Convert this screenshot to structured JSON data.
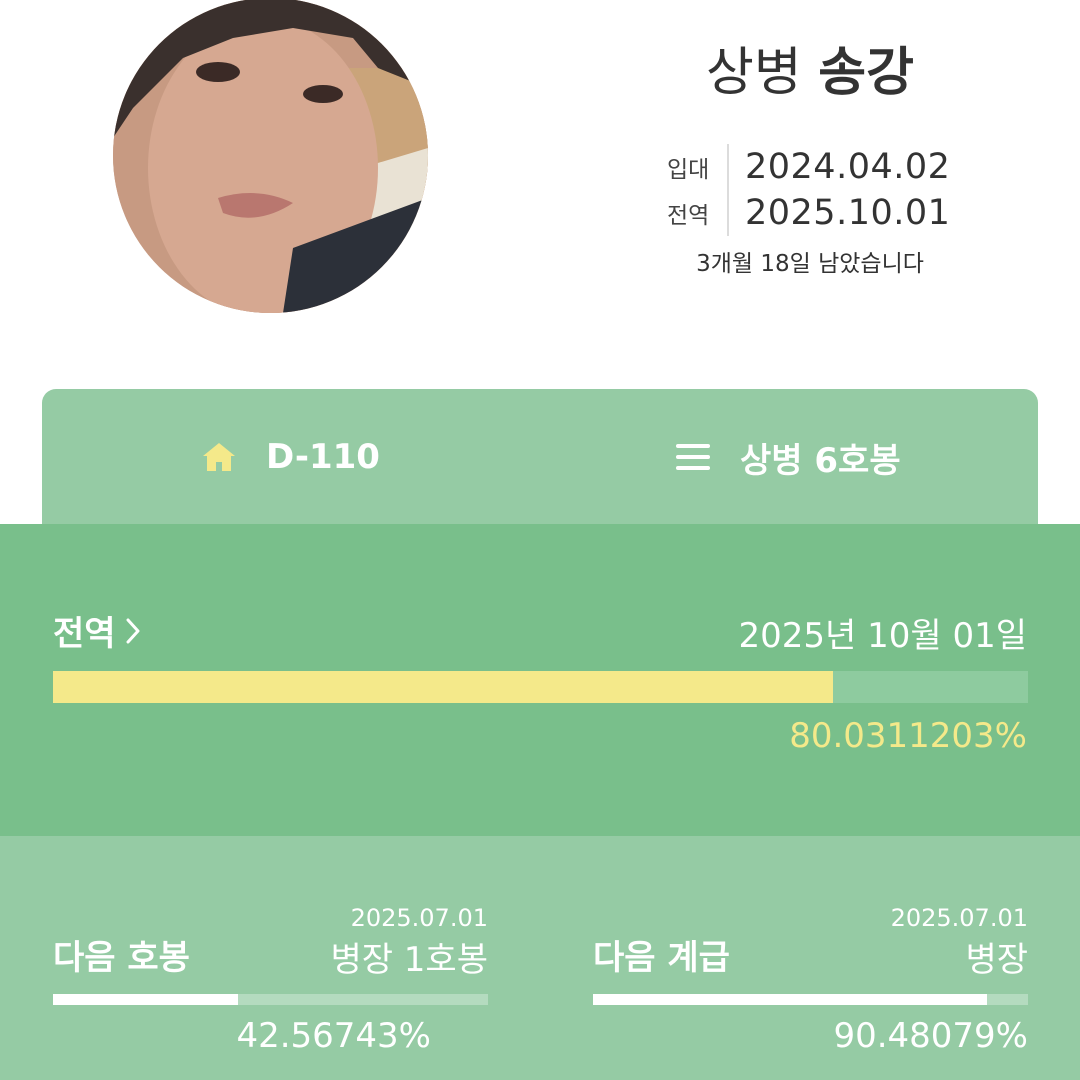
{
  "profile": {
    "rank": "상병",
    "name": "송강",
    "enlist_label": "입대",
    "enlist_date": "2024.04.02",
    "discharge_label": "전역",
    "discharge_date": "2025.10.01",
    "remaining": "3개월 18일 남았습니다"
  },
  "tabs": {
    "dday_label": "D-110",
    "dday_icon": "home-icon",
    "rank_label": "상병 6호봉",
    "rank_icon": "menu-icon"
  },
  "discharge": {
    "label": "전역",
    "date": "2025년 10월 01일",
    "percent_text": "80.0311203%",
    "progress": 0.800311203
  },
  "next_step": {
    "title": "다음 호봉",
    "date": "2025.07.01",
    "value": "병장 1호봉",
    "percent_text": "42.56743%",
    "progress": 0.4256743
  },
  "next_rank": {
    "title": "다음 계급",
    "date": "2025.07.01",
    "value": "병장",
    "percent_text": "90.48079%",
    "progress": 0.9048079
  },
  "colors": {
    "tab_bg": "#95cba4",
    "main_bg": "#79bf8b",
    "accent_yellow": "#f4e98a",
    "white": "#ffffff"
  }
}
